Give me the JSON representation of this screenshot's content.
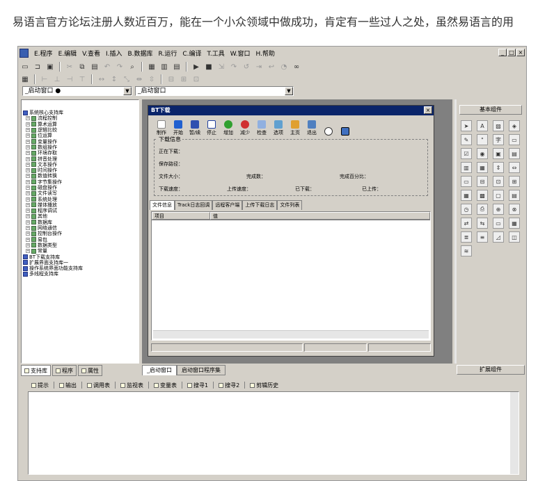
{
  "article": {
    "text": "易语言官方论坛注册人数近百万，能在一个小众领域中做成功，肯定有一些过人之处，虽然易语言的用"
  },
  "menubar": {
    "items": [
      "E.程序",
      "E.编辑",
      "V.查看",
      "I.插入",
      "B.数据库",
      "R.运行",
      "C.编译",
      "T.工具",
      "W.窗口",
      "H.帮助"
    ],
    "window_controls": [
      "_",
      "□",
      "×"
    ]
  },
  "combos": {
    "left": "_启动窗口 ●",
    "right": "_启动窗口"
  },
  "left_panel": {
    "tree": [
      "系统核心支持库",
      "流程控制",
      "算术运算",
      "逻辑比较",
      "位运算",
      "变量操作",
      "数组操作",
      "环境存取",
      "拼音处理",
      "文本操作",
      "时间操作",
      "数值转换",
      "字节集操作",
      "磁盘操作",
      "文件读写",
      "系统处理",
      "媒体播放",
      "程序调试",
      "其他",
      "数据库",
      "网络通信",
      "控制台操作",
      "易包",
      "数据类型",
      "常量",
      "BT下载支持库",
      "扩展界面支持库一",
      "操作系统界面功能支持库",
      "多线程支持库"
    ],
    "tabs": [
      "支持库",
      "程序",
      "属性"
    ]
  },
  "form": {
    "title": "BT下载",
    "buttons": [
      "制作",
      "开始",
      "暂/续",
      "停止",
      "增加",
      "减少",
      "检查",
      "选项",
      "主页",
      "退出"
    ],
    "group_title": "下载信息",
    "labels": {
      "downloading": "正在下载：",
      "save_path": "保存路径：",
      "file_size": "文件大小：",
      "completed": "完成数：",
      "percent": "完成百分比：",
      "down_speed": "下载速度：",
      "up_speed": "上传速度：",
      "downloaded": "已下载：",
      "uploaded": "已上传："
    },
    "tabs": [
      "文件信息",
      "Track日志回调",
      "远程客户端",
      "上传下载日志",
      "文件列表"
    ],
    "columns": [
      "项目",
      "值"
    ]
  },
  "editor_tabs": [
    "_启动窗口",
    "启动窗口程序集"
  ],
  "right_panel": {
    "header": "基本组件",
    "footer": "扩展组件"
  },
  "bottom_tabs": [
    "提示",
    "输出",
    "调用表",
    "监视表",
    "变量表",
    "搜寻1",
    "搜寻2",
    "剪辑历史"
  ]
}
